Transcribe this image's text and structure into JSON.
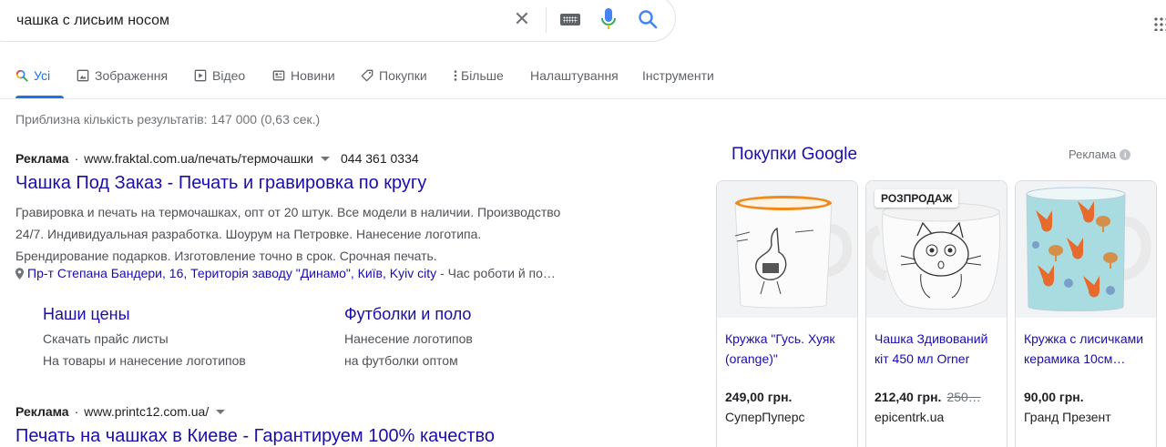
{
  "search": {
    "query": "чашка с лисьим носом"
  },
  "tabs": [
    {
      "label": "Усі",
      "icon": "search-multicolor-icon",
      "active": true
    },
    {
      "label": "Зображення",
      "icon": "image-icon"
    },
    {
      "label": "Відео",
      "icon": "play-icon"
    },
    {
      "label": "Новини",
      "icon": "news-icon"
    },
    {
      "label": "Покупки",
      "icon": "tag-icon"
    },
    {
      "label": "Більше",
      "icon": "more-vert-icon"
    },
    {
      "label": "Налаштування"
    },
    {
      "label": "Інструменти"
    }
  ],
  "stats": "Приблизна кількість результатів: 147 000 (0,63 сек.)",
  "ads": [
    {
      "label": "Реклама",
      "url": "www.fraktal.com.ua/печать/термочашки",
      "phone": "044 361 0334",
      "title": "Чашка Под Заказ - Печать и гравировка по кругу",
      "description": [
        "Гравировка и печать на термочашках, опт от 20 штук. Все модели в наличии. Производство",
        "24/7. Индивидуальная разработка. Шоурум на Петровке. Нанесение логотипа.",
        "Брендирование подарков. Изготовление точно в срок. Срочная печать."
      ],
      "address_link": "Пр-т Степана Бандери, 16, Територія заводу \"Динамо\", Київ, Kyiv city",
      "address_rest": " - Час роботи й по…",
      "sitelinks": [
        {
          "title": "Наши цены",
          "lines": [
            "Скачать прайс листы",
            "На товары и нанесение логотипов"
          ]
        },
        {
          "title": "Футболки и поло",
          "lines": [
            "Нанесение логотипов",
            "на футболки оптом"
          ]
        }
      ]
    },
    {
      "label": "Реклама",
      "url": "www.printc12.com.ua/",
      "title": "Печать на чашках в Киеве - Гарантируем 100% качество"
    }
  ],
  "shopping": {
    "title": "Покупки Google",
    "ad_label": "Реклама",
    "products": [
      {
        "name": "Кружка \"Гусь. Хуяк (orange)\"",
        "price": "249,00 грн.",
        "old_price": "",
        "store": "СуперПуперс",
        "badge": ""
      },
      {
        "name": "Чашка Здивований кіт 450 мл Orner",
        "price": "212,40 грн.",
        "old_price": "250…",
        "store": "epicentrk.ua",
        "badge": "РОЗПРОДАЖ"
      },
      {
        "name": "Кружка с лисичками керамика 10см…",
        "price": "90,00 грн.",
        "old_price": "",
        "store": "Гранд Презент",
        "badge": ""
      }
    ]
  },
  "colors": {
    "link": "#1a0dab",
    "accent": "#1a73e8",
    "muted": "#70757a"
  }
}
